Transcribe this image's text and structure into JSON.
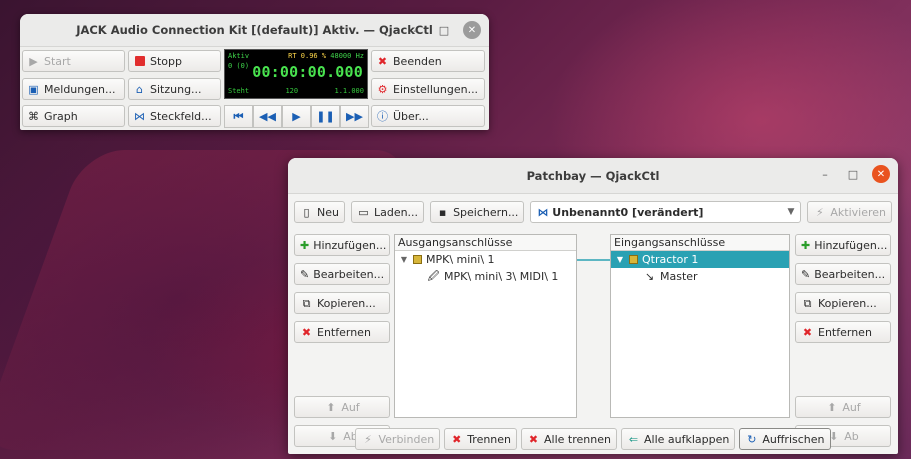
{
  "jack": {
    "title": "JACK Audio Connection Kit [(default)] Aktiv. — QjackCtl",
    "buttons": {
      "start": "Start",
      "stop": "Stopp",
      "quit": "Beenden",
      "messages": "Meldungen...",
      "session": "Sitzung...",
      "settings": "Einstellungen...",
      "graph": "Graph",
      "connections": "Steckfeld...",
      "about": "Über..."
    },
    "display": {
      "status": "Aktiv",
      "rt": "RT",
      "dsp": "0.96 %",
      "rate": "48000 Hz",
      "xruns": "0 (0)",
      "time": "00:00:00.000",
      "transport_state": "Steht",
      "bpm": "120",
      "bbt": "1.1.000"
    }
  },
  "patchbay": {
    "title": "Patchbay — QjackCtl",
    "toolbar": {
      "new": "Neu",
      "load": "Laden...",
      "save": "Speichern...",
      "preset": "Unbenannt0 [verändert]",
      "activate": "Aktivieren"
    },
    "left_buttons": {
      "add": "Hinzufügen...",
      "edit": "Bearbeiten...",
      "copy": "Kopieren...",
      "remove": "Entfernen",
      "up": "Auf",
      "down": "Ab"
    },
    "right_buttons": {
      "add": "Hinzufügen...",
      "edit": "Bearbeiten...",
      "copy": "Kopieren...",
      "remove": "Entfernen",
      "up": "Auf",
      "down": "Ab"
    },
    "output_header": "Ausgangsanschlüsse",
    "input_header": "Eingangsanschlüsse",
    "outputs": [
      {
        "label": "MPK\\ mini\\ 1"
      },
      {
        "label": "MPK\\ mini\\ 3\\ MIDI\\ 1"
      }
    ],
    "inputs": [
      {
        "label": "Qtractor 1"
      },
      {
        "label": "Master"
      }
    ],
    "bottom": {
      "connect": "Verbinden",
      "disconnect": "Trennen",
      "disconnect_all": "Alle trennen",
      "expand_all": "Alle aufklappen",
      "refresh": "Auffrischen"
    }
  },
  "colors": {
    "selection": "#2aa1b3",
    "close_button": "#e9531f",
    "timecode": "#49e34f"
  }
}
